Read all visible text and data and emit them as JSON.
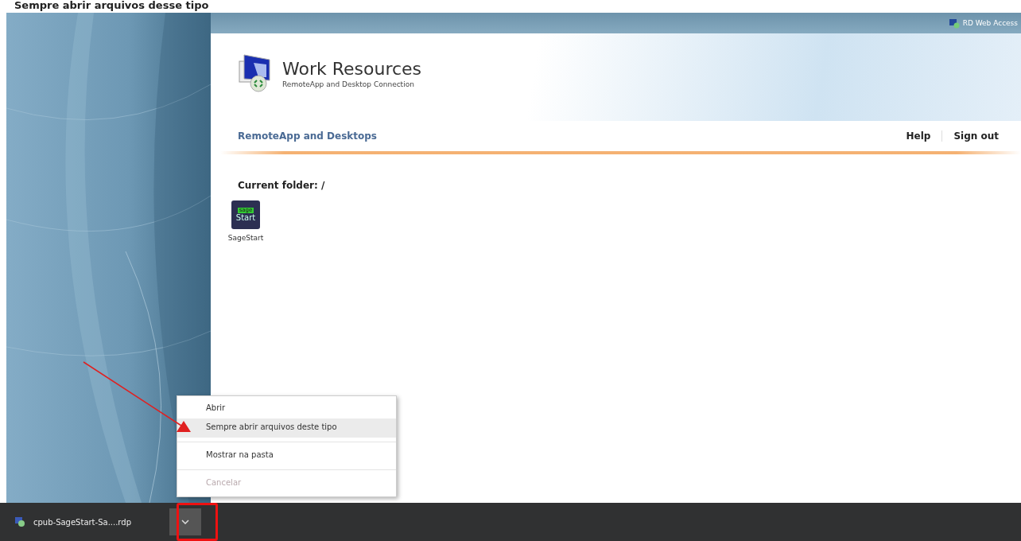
{
  "caption": "Sempre abrir arquivos desse tipo",
  "web_access": {
    "badge": "RD Web Access",
    "title": "Work Resources",
    "subtitle": "RemoteApp and Desktop Connection",
    "nav_title": "RemoteApp and Desktops",
    "links": [
      "Help",
      "Sign out"
    ],
    "folder_label": "Current folder: /",
    "apps": [
      {
        "label": "SageStart",
        "icon_top": "sage",
        "icon_bottom": "Start"
      }
    ]
  },
  "download_bar": {
    "filename": "cpub-SageStart-Sa....rdp",
    "menu": [
      [
        {
          "label": "Abrir",
          "selected": false,
          "disabled": false
        },
        {
          "label": "Sempre abrir arquivos deste tipo",
          "selected": true,
          "disabled": false
        }
      ],
      [
        {
          "label": "Mostrar na pasta",
          "selected": false,
          "disabled": false
        }
      ],
      [
        {
          "label": "Cancelar",
          "selected": false,
          "disabled": true
        }
      ]
    ]
  }
}
